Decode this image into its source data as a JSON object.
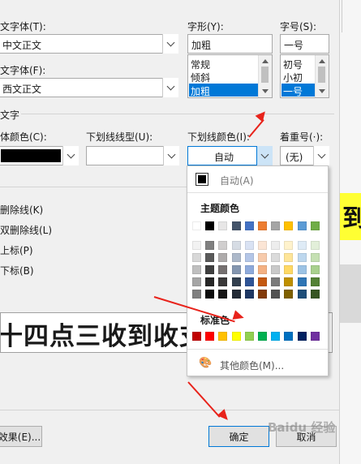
{
  "dialog": {
    "asian_font": {
      "label": "文字体(T):",
      "value": "中文正文"
    },
    "western_font": {
      "label": "文字体(F):",
      "value": "西文正文"
    },
    "font_style": {
      "label": "字形(Y):",
      "value": "加粗",
      "options": [
        "常规",
        "倾斜",
        "加粗"
      ],
      "selected": "加粗"
    },
    "font_size": {
      "label": "字号(S):",
      "value": "一号",
      "options": [
        "初号",
        "小初",
        "一号"
      ],
      "selected": "一号"
    },
    "section_title": "文字",
    "font_color": {
      "label": "体颜色(C):",
      "value_color": "#000000"
    },
    "underline_type": {
      "label": "下划线线型(U):",
      "value": ""
    },
    "underline_color": {
      "label": "下划线颜色(I):",
      "value": "自动"
    },
    "emphasis_mark": {
      "label": "着重号(·):",
      "value": "(无)"
    },
    "effects": [
      {
        "label": "删除线(K)"
      },
      {
        "label": "双删除线(L)"
      },
      {
        "label": "上标(P)"
      },
      {
        "label": "下标(B)"
      }
    ],
    "preview_text": "十四点三收到收支",
    "text_effects_button": "效果(E)...",
    "ok_button": "确定",
    "cancel_button": "取消"
  },
  "color_palette": {
    "auto_label": "自动(A)",
    "auto_color": "#000000",
    "theme_title": "主题颜色",
    "theme_top": [
      "#ffffff",
      "#000000",
      "#e7e6e6",
      "#44546a",
      "#4472c4",
      "#ed7d31",
      "#a5a5a5",
      "#ffc000",
      "#5b9bd5",
      "#70ad47"
    ],
    "theme_shades": [
      [
        "#f2f2f2",
        "#7f7f7f",
        "#d0cece",
        "#d6dce4",
        "#d9e2f3",
        "#fbe5d5",
        "#ededed",
        "#fff2cc",
        "#deebf6",
        "#e2efd9"
      ],
      [
        "#d8d8d8",
        "#595959",
        "#aeabab",
        "#adb9ca",
        "#b4c6e7",
        "#f7cbac",
        "#dbdbdb",
        "#fee599",
        "#bdd7ee",
        "#c5e0b3"
      ],
      [
        "#bfbfbf",
        "#3f3f3f",
        "#757070",
        "#8496b0",
        "#8eaadb",
        "#f4b183",
        "#c9c9c9",
        "#ffd965",
        "#9cc3e5",
        "#a8d08d"
      ],
      [
        "#a5a5a5",
        "#262626",
        "#3a3838",
        "#323f4f",
        "#2f5496",
        "#c45911",
        "#7b7b7b",
        "#bf9000",
        "#2e75b5",
        "#538135"
      ],
      [
        "#7f7f7f",
        "#0c0c0c",
        "#171616",
        "#222a35",
        "#1f3864",
        "#833c0b",
        "#525252",
        "#7f6000",
        "#1e4e79",
        "#375623"
      ]
    ],
    "standard_title": "标准色",
    "standard_colors": [
      "#c00000",
      "#ff0000",
      "#ffc000",
      "#ffff00",
      "#92d050",
      "#00b050",
      "#00b0f0",
      "#0070c0",
      "#002060",
      "#7030a0"
    ],
    "more_colors_label": "其他颜色(M)..."
  },
  "background": {
    "char_1": "到",
    "char_2": "|"
  },
  "watermark": "Baidu 经验",
  "annotation_color": "#e8231b"
}
